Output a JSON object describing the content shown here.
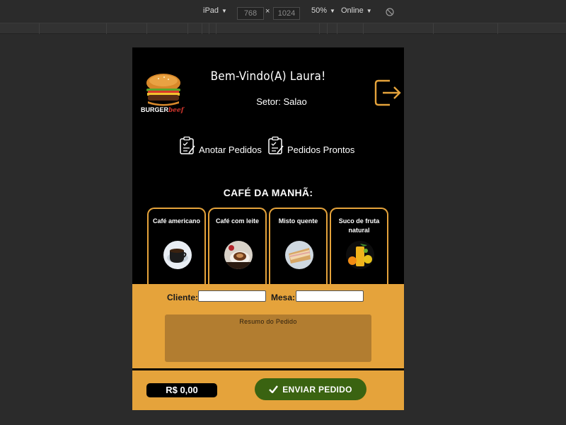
{
  "devtools": {
    "device": "iPad",
    "width": "768",
    "times": "×",
    "height": "1024",
    "zoom": "50%",
    "network": "Online"
  },
  "header": {
    "logo_brand": "BURGER",
    "logo_brand_suffix": "beef",
    "welcome": "Bem-Vindo(A) Laura!",
    "sector": "Setor: Salao"
  },
  "nav": {
    "take_orders": "Anotar Pedidos",
    "ready_orders": "Pedidos Prontos"
  },
  "menu": {
    "section_title": "CAFÉ DA MANHÃ:",
    "items": [
      {
        "name": "Café americano"
      },
      {
        "name": "Café com leite"
      },
      {
        "name": "Misto quente"
      },
      {
        "name": "Suco de fruta natural"
      }
    ]
  },
  "order": {
    "client_label": "Cliente:",
    "table_label": "Mesa:",
    "client_value": "",
    "table_value": "",
    "summary_placeholder": "Resumo do Pedido"
  },
  "footer": {
    "total": "R$ 0,00",
    "send_label": "ENVIAR PEDIDO"
  },
  "colors": {
    "accent": "#e5a33b",
    "send_button": "#3a6311",
    "summary_bg": "#b27d30",
    "background": "#000000"
  }
}
